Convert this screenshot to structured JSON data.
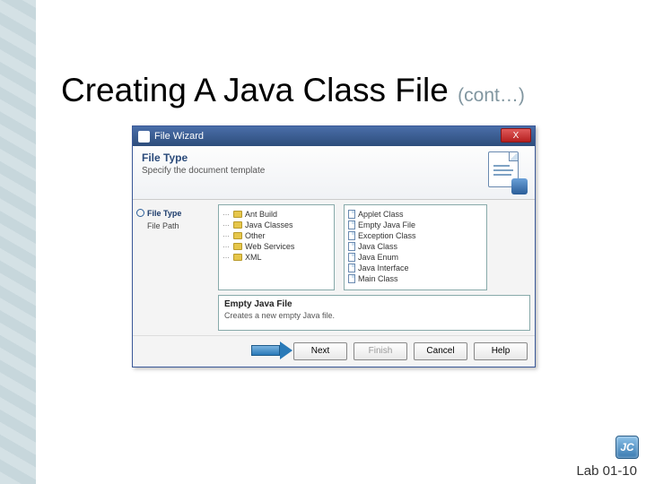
{
  "slide": {
    "title_main": "Creating A Java Class File ",
    "title_cont": "(cont…)",
    "footer": "Lab 01-10",
    "logo_text": "JC"
  },
  "wizard": {
    "window_title": "File Wizard",
    "header_title": "File Type",
    "header_subtitle": "Specify the document template",
    "steps": [
      {
        "label": "File Type",
        "active": true
      },
      {
        "label": "File Path",
        "active": false
      }
    ],
    "categories": [
      "Ant Build",
      "Java Classes",
      "Other",
      "Web Services",
      "XML"
    ],
    "templates": [
      "Applet Class",
      "Empty Java File",
      "Exception Class",
      "Java Class",
      "Java Enum",
      "Java Interface",
      "Main Class"
    ],
    "desc_title": "Empty Java File",
    "desc_text": "Creates a new empty Java file.",
    "buttons": {
      "next": "Next",
      "finish": "Finish",
      "cancel": "Cancel",
      "help": "Help"
    }
  }
}
